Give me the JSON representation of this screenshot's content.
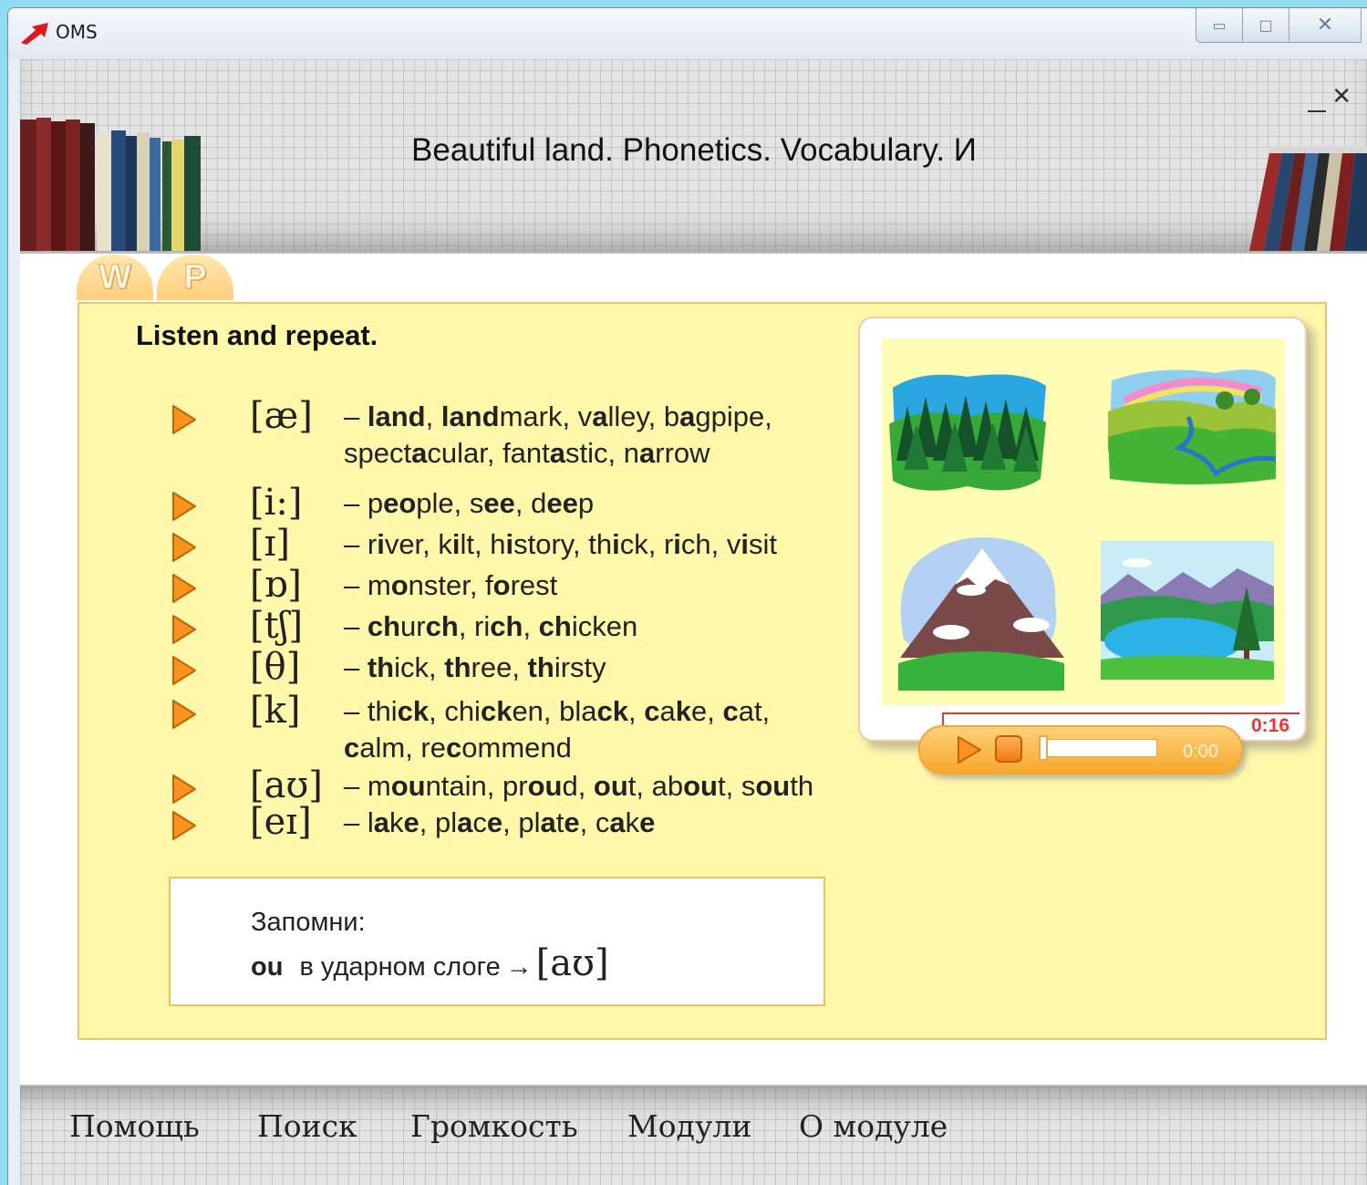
{
  "window": {
    "app_title": "OMS",
    "minimize_glyph": "▭",
    "maximize_glyph": "□",
    "close_glyph": "✕"
  },
  "header": {
    "module_title": "Beautiful land. Phonetics. Vocabulary. И",
    "inner_close_glyph": "✕"
  },
  "tabs": [
    {
      "label": "W"
    },
    {
      "label": "P"
    }
  ],
  "exercise": {
    "instruction": "Listen and repeat.",
    "rows": [
      {
        "symbol": "[æ]",
        "words": [
          "– ",
          {
            "b": "land"
          },
          ", ",
          {
            "b": "land"
          },
          "mark, v",
          {
            "b": "a"
          },
          "lley, b",
          {
            "b": "a"
          },
          "gpipe, spect",
          {
            "b": "a"
          },
          "cular, fant",
          {
            "b": "a"
          },
          "stic, n",
          {
            "b": "a"
          },
          "rrow"
        ]
      },
      {
        "symbol": "[i:]",
        "words": [
          "– p",
          {
            "b": "eo"
          },
          "ple, s",
          {
            "b": "ee"
          },
          ", d",
          {
            "b": "ee"
          },
          "p"
        ]
      },
      {
        "symbol": "[ɪ]",
        "words": [
          "– r",
          {
            "b": "i"
          },
          "ver, k",
          {
            "b": "i"
          },
          "lt, h",
          {
            "b": "i"
          },
          "story, th",
          {
            "b": "i"
          },
          "ck, r",
          {
            "b": "i"
          },
          "ch, v",
          {
            "b": "i"
          },
          "sit"
        ]
      },
      {
        "symbol": "[ɒ]",
        "words": [
          "– m",
          {
            "b": "o"
          },
          "nster, f",
          {
            "b": "o"
          },
          "rest"
        ]
      },
      {
        "symbol": "[tʃ]",
        "words": [
          "– ",
          {
            "b": "ch"
          },
          "ur",
          {
            "b": "ch"
          },
          ", ri",
          {
            "b": "ch"
          },
          ", ",
          {
            "b": "ch"
          },
          "icken"
        ]
      },
      {
        "symbol": "[θ]",
        "words": [
          "– ",
          {
            "b": "th"
          },
          "ick, ",
          {
            "b": "th"
          },
          "ree, ",
          {
            "b": "th"
          },
          "irsty"
        ]
      },
      {
        "symbol": "[k]",
        "words": [
          "– thi",
          {
            "b": "ck"
          },
          ", chi",
          {
            "b": "ck"
          },
          "en, bla",
          {
            "b": "ck"
          },
          ", ",
          {
            "b": "c"
          },
          "a",
          {
            "b": "k"
          },
          "e, ",
          {
            "b": "c"
          },
          "at, ",
          {
            "b": "c"
          },
          "alm, re",
          {
            "b": "c"
          },
          "ommend"
        ]
      },
      {
        "symbol": "[aʊ]",
        "words": [
          "– m",
          {
            "b": "ou"
          },
          "ntain, pr",
          {
            "b": "ou"
          },
          "d, ",
          {
            "b": "ou"
          },
          "t, ab",
          {
            "b": "ou"
          },
          "t, s",
          {
            "b": "ou"
          },
          "th"
        ]
      },
      {
        "symbol": "[eɪ]",
        "words": [
          "– l",
          {
            "b": "a"
          },
          "k",
          {
            "b": "e"
          },
          ", pl",
          {
            "b": "a"
          },
          "c",
          {
            "b": "e"
          },
          ", pl",
          {
            "b": "a"
          },
          "t",
          {
            "b": "e"
          },
          ", c",
          {
            "b": "a"
          },
          "k",
          {
            "b": "e"
          }
        ]
      }
    ],
    "remember": {
      "title": "Запомни:",
      "ou": "ou",
      "text": "в ударном слоге",
      "arrow": "→",
      "symbol": "[aʊ]"
    }
  },
  "player": {
    "total_time": "0:16",
    "current_time": "0:00",
    "progress": 0
  },
  "menu": {
    "help": "Помощь",
    "search": "Поиск",
    "volume": "Громкость",
    "modules": "Модули",
    "about": "О модуле"
  },
  "colors": {
    "panel_bg": "#fff8aa",
    "accent_orange": "#f7931e",
    "time_red": "#e33333"
  }
}
